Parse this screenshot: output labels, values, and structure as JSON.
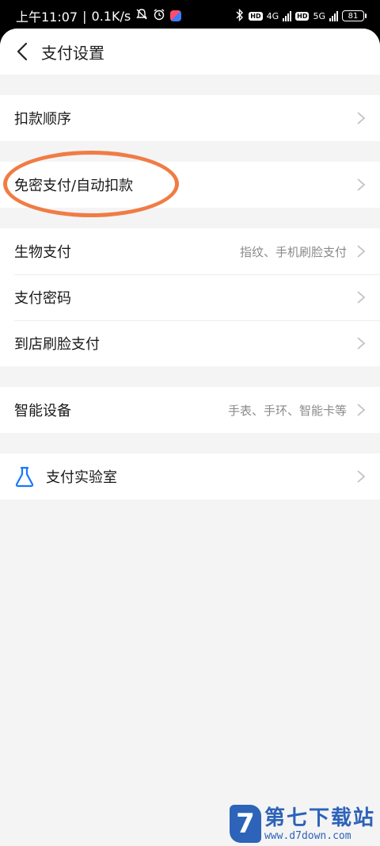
{
  "status_bar": {
    "time": "上午11:07",
    "separator": "|",
    "net_speed": "0.1K/s",
    "hd1": "HD",
    "net1": "4G",
    "hd2": "HD",
    "net2": "5G",
    "battery": "81"
  },
  "header": {
    "title": "支付设置",
    "back_icon": "chevron-left-icon"
  },
  "groups": [
    {
      "rows": [
        {
          "label": "扣款顺序",
          "value": ""
        }
      ]
    },
    {
      "rows": [
        {
          "label": "免密支付/自动扣款",
          "value": "",
          "highlighted": true
        }
      ]
    },
    {
      "rows": [
        {
          "label": "生物支付",
          "value": "指纹、手机刷脸支付"
        },
        {
          "label": "支付密码",
          "value": ""
        },
        {
          "label": "到店刷脸支付",
          "value": ""
        }
      ]
    },
    {
      "rows": [
        {
          "label": "智能设备",
          "value": "手表、手环、智能卡等"
        }
      ]
    },
    {
      "rows": [
        {
          "label": "支付实验室",
          "value": "",
          "icon": "flask-icon"
        }
      ]
    }
  ],
  "colors": {
    "highlight": "#f07c45",
    "lab_icon": "#1677ff",
    "watermark": "#2d63b8"
  },
  "watermark": {
    "logo_letter": "7",
    "name": "第七下载站",
    "url": "www.d7down.com"
  }
}
